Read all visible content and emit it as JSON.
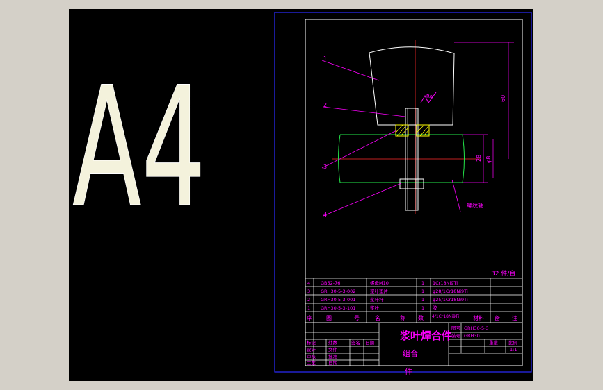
{
  "sheet": {
    "size_label": "A4",
    "qty_note": "32 件/台"
  },
  "balloons": [
    "1",
    "2",
    "3",
    "4"
  ],
  "dimensions": {
    "height": "60",
    "width": "28",
    "shaft": "φ8",
    "roughness": "Ra",
    "shaft_note": "螺纹轴"
  },
  "parts_table": {
    "header": [
      "序",
      "图",
      "号",
      "名",
      "称",
      "数",
      "量",
      "材料",
      "备",
      "注"
    ],
    "rows": [
      {
        "no": "4",
        "code": "GB52-76",
        "name": "螺母M10",
        "qty": "1",
        "material": "1Cr18Ni9Ti"
      },
      {
        "no": "3",
        "code": "GRH30-5-3-002",
        "name": "浆叶垫片",
        "qty": "1",
        "material": "φ28/1Cr18Ni9Ti"
      },
      {
        "no": "2",
        "code": "GRH30-5-3-001",
        "name": "浆叶杆",
        "qty": "1",
        "material": "φ25/1Cr18Ni9Ti"
      },
      {
        "no": "1",
        "code": "GRH30-5-3-101",
        "name": "浆叶",
        "qty": "1",
        "material": "胶"
      }
    ],
    "material_note": "4/1Cr18Ni9Ti"
  },
  "title_block": {
    "title": "浆叶焊合件",
    "sub1": "组合",
    "sub2": "件",
    "drawing_no_label": "图号",
    "drawing_no": "GRH30-5-3",
    "part_no_label": "装号",
    "part_no": "GRH30",
    "col_labels": [
      "重量",
      "比例"
    ],
    "scale": "1:1",
    "rows_left": [
      "标记",
      "设计",
      "审核",
      "工艺"
    ],
    "rows_mid": [
      "处数",
      "文件",
      "批准",
      "日期"
    ],
    "rows_right": [
      "签名",
      "日期"
    ]
  },
  "colors": {
    "background": "#000000",
    "frame": "#2b2bff",
    "text": "#ff00ff",
    "center_line": "#ff2a2a",
    "shaft": "#24e84a",
    "parts": "#ffffff",
    "hatch": "#ffff00",
    "glyph": "#f4f2dc"
  }
}
